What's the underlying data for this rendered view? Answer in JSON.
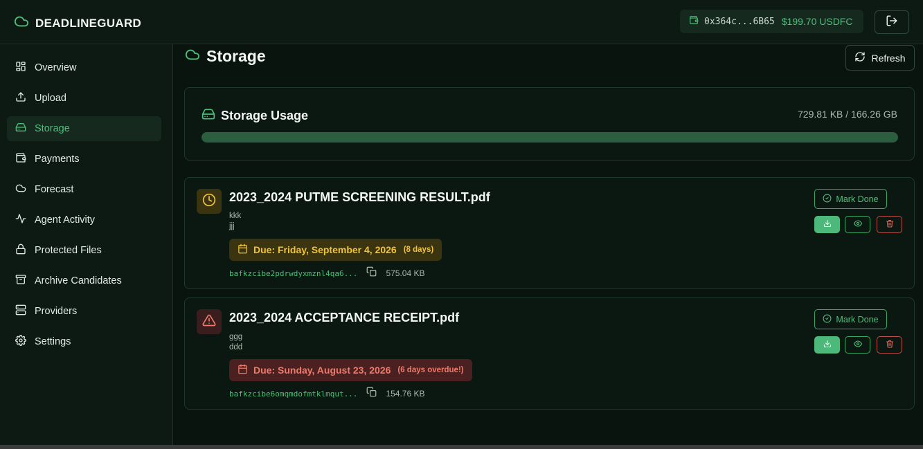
{
  "app": {
    "name": "DEADLINEGUARD"
  },
  "wallet": {
    "address": "0x364c...6B65",
    "balance": "$199.70 USDFC"
  },
  "sidebar": {
    "items": [
      {
        "label": "Overview",
        "icon": "grid-icon"
      },
      {
        "label": "Upload",
        "icon": "upload-icon"
      },
      {
        "label": "Storage",
        "icon": "hard-drive-icon",
        "active": true
      },
      {
        "label": "Payments",
        "icon": "wallet-icon"
      },
      {
        "label": "Forecast",
        "icon": "cloud-icon"
      },
      {
        "label": "Agent Activity",
        "icon": "activity-icon"
      },
      {
        "label": "Protected Files",
        "icon": "lock-icon"
      },
      {
        "label": "Archive Candidates",
        "icon": "archive-icon"
      },
      {
        "label": "Providers",
        "icon": "server-icon"
      },
      {
        "label": "Settings",
        "icon": "gear-icon"
      }
    ]
  },
  "main": {
    "title": "Storage",
    "refresh_label": "Refresh",
    "usage": {
      "title": "Storage Usage",
      "amount": "729.81 KB / 166.26 GB",
      "fill_fraction": 1.0
    },
    "files": [
      {
        "name": "2023_2024 PUTME SCREENING RESULT.pdf",
        "desc_line1": "kkk",
        "desc_line2": "jjj",
        "due": "Due: Friday, September 4, 2026",
        "due_note": "(8 days)",
        "status": "warning",
        "cid": "bafkzcibe2pdrwdyxmznl4qa6...",
        "size": "575.04 KB",
        "mark_done_label": "Mark Done"
      },
      {
        "name": "2023_2024 ACCEPTANCE RECEIPT.pdf",
        "desc_line1": "ggg",
        "desc_line2": "ddd",
        "due": "Due: Sunday, August 23, 2026",
        "due_note": "(6 days overdue!)",
        "status": "overdue",
        "cid": "bafkzcibe6omqmdofmtklmqut...",
        "size": "154.76 KB",
        "mark_done_label": "Mark Done"
      }
    ]
  },
  "colors": {
    "accent": "#4cc07a",
    "warning": "#f0c33a",
    "danger": "#f07a6a",
    "background": "#0a140f"
  }
}
